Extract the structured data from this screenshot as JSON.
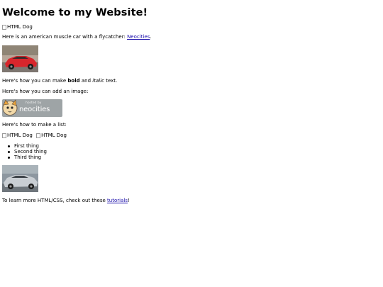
{
  "header": {
    "title": "Welcome to my Website!"
  },
  "content": {
    "broken_image_alt": "HTML Dog",
    "intro_text": "Here is an american muscle car with a flycatcher: ",
    "intro_link": "Neocities",
    "intro_end": ".",
    "format_pre": "Here's how you can make ",
    "format_bold": "bold",
    "format_mid": " and ",
    "format_italic": "italic",
    "format_post": " text.",
    "image_text": "Here's how you can add an image:",
    "badge": {
      "top_text": "hosted by",
      "brand_text": "neocities"
    },
    "list_intro": "Here's how to make a list:",
    "list_items": [
      "First thing",
      "Second thing",
      "Third thing"
    ],
    "footer_text": "To learn more HTML/CSS, check out these ",
    "footer_link": "tutorials",
    "footer_end": "!"
  },
  "colors": {
    "link": "#1a0dab",
    "badge_bg": "#9ea4a6",
    "red_car": "#d8262c",
    "silver_car": "#c9ced3"
  }
}
